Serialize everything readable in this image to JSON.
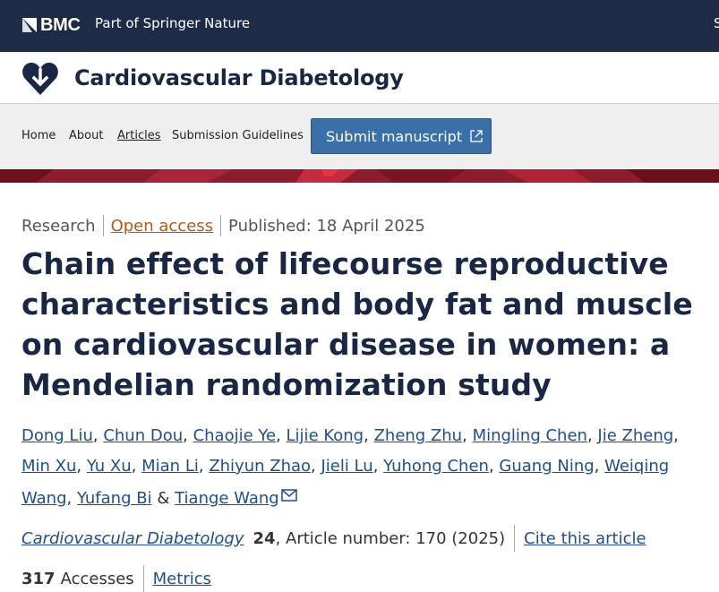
{
  "topbar": {
    "brand": "BMC",
    "tagline": "Part of Springer Nature",
    "edge_letter": "S"
  },
  "journal": {
    "name": "Cardiovascular Diabetology"
  },
  "nav": {
    "home": "Home",
    "about": "About",
    "articles": "Articles",
    "guidelines": "Submission Guidelines",
    "submit": "Submit manuscript"
  },
  "article": {
    "type": "Research",
    "access": "Open access",
    "published": "Published: 18 April 2025",
    "title": "Chain effect of lifecourse reproductive characteristics and body fat and muscle on cardiovascular disease in women: a Mendelian randomization study",
    "authors": [
      "Dong Liu",
      "Chun Dou",
      "Chaojie Ye",
      "Lijie Kong",
      "Zheng Zhu",
      "Mingling Chen",
      "Jie Zheng",
      "Min Xu",
      "Yu Xu",
      "Mian Li",
      "Zhiyun Zhao",
      "Jieli Lu",
      "Yuhong Chen",
      "Guang Ning",
      "Weiqing Wang",
      "Yufang Bi",
      "Tiange Wang"
    ],
    "amp": "&",
    "citation": {
      "journal": "Cardiovascular Diabetology",
      "volume": "24",
      "article_number": ", Article number: 170 (2025)",
      "cite_link": "Cite this article"
    },
    "accesses_count": "317",
    "accesses_label": "Accesses",
    "metrics": "Metrics"
  },
  "colors": {
    "topbar": "#1e2b47",
    "link": "#1f4e8c",
    "title": "#1a2744",
    "open_access": "#b05a1d",
    "banner": "#8c1c2c",
    "submit_button": "#3b6fa8"
  }
}
